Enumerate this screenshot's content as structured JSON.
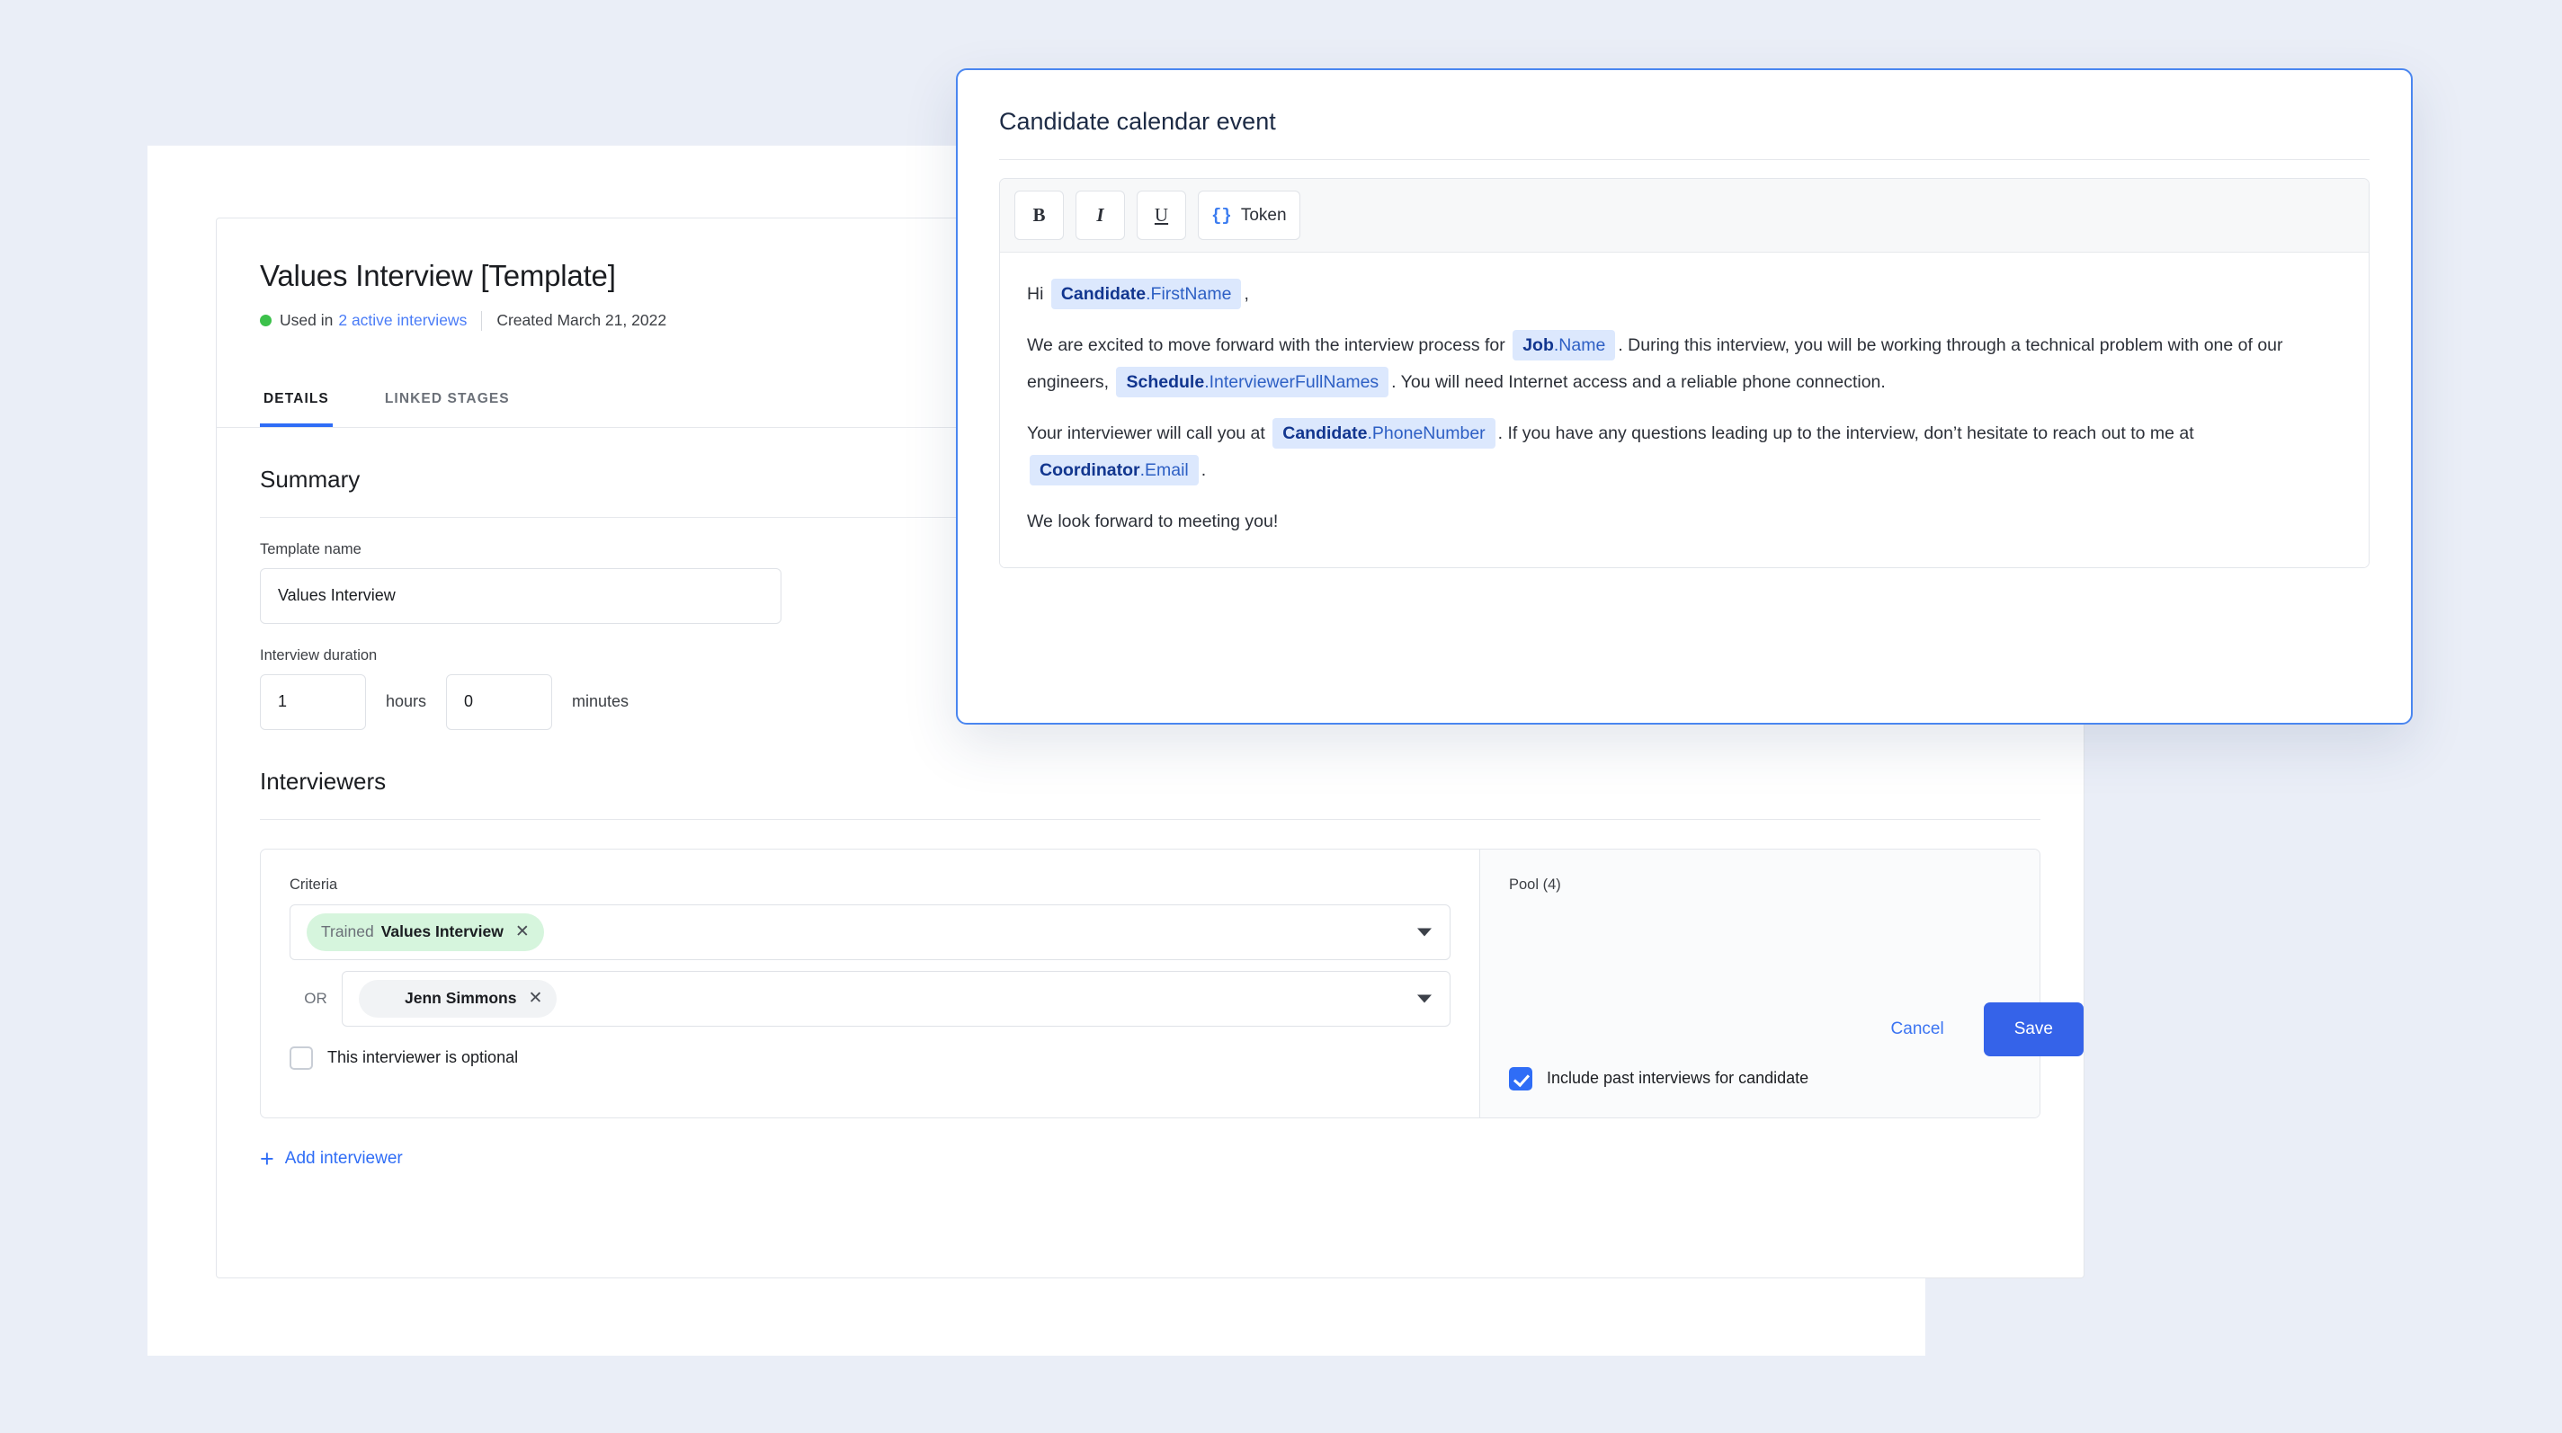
{
  "header": {
    "title": "Values Interview [Template]",
    "used_in_prefix": "Used in",
    "used_in_link": "2 active interviews",
    "created": "Created March 21, 2022"
  },
  "tabs": [
    {
      "label": "DETAILS",
      "active": true
    },
    {
      "label": "LINKED STAGES",
      "active": false
    }
  ],
  "summary": {
    "section_title": "Summary",
    "template_name_label": "Template name",
    "template_name_value": "Values Interview",
    "duration_label": "Interview duration",
    "hours_value": "1",
    "hours_unit": "hours",
    "minutes_value": "0",
    "minutes_unit": "minutes"
  },
  "interviewers": {
    "section_title": "Interviewers",
    "criteria_label": "Criteria",
    "criteria_chip": {
      "prefix": "Trained",
      "main": "Values Interview",
      "remove": "✕"
    },
    "or_label": "OR",
    "person_chip": {
      "name": "Jenn Simmons",
      "remove": "✕"
    },
    "optional_label": "This interviewer is optional",
    "optional_checked": false,
    "pool_label": "Pool (4)",
    "pool_avatars": [
      {
        "bg": "#f5d130",
        "hair": "#6b3a1f",
        "body": "#6ea3cf"
      },
      {
        "bg": "#8c2fd4",
        "hair": "#151215",
        "body": "#2b2b33"
      },
      {
        "bg": "#2f6df6",
        "hair": "#231a14",
        "body": "#2e3440"
      },
      {
        "bg": "#5ef0e2",
        "hair": "#c9a06a",
        "body": "#e6dfd6"
      }
    ],
    "include_past_label": "Include past interviews for candidate",
    "include_past_checked": true,
    "add_interviewer_label": "Add interviewer",
    "add_interviewer_icon": "+"
  },
  "modal": {
    "title": "Candidate calendar event",
    "toolbar": {
      "bold": "B",
      "italic": "I",
      "underline": "U",
      "token_braces": "{}",
      "token_label": "Token"
    },
    "body": [
      {
        "parts": [
          {
            "t": "text",
            "v": "Hi "
          },
          {
            "t": "token",
            "obj": "Candidate",
            "field": ".FirstName"
          },
          {
            "t": "text",
            "v": ","
          }
        ]
      },
      {
        "parts": [
          {
            "t": "text",
            "v": "We are excited to move forward with the interview process for "
          },
          {
            "t": "token",
            "obj": "Job",
            "field": ".Name"
          },
          {
            "t": "text",
            "v": ". During this interview, you will be working through a technical problem with one of our engineers, "
          },
          {
            "t": "token",
            "obj": "Schedule",
            "field": ".InterviewerFullNames"
          },
          {
            "t": "text",
            "v": ". You will need Internet access and a reliable phone connection."
          }
        ]
      },
      {
        "parts": [
          {
            "t": "text",
            "v": "Your interviewer will call you at "
          },
          {
            "t": "token",
            "obj": "Candidate",
            "field": ".PhoneNumber"
          },
          {
            "t": "text",
            "v": ". If you have any questions leading up to the interview, don’t hesitate to reach out to me at "
          },
          {
            "t": "token",
            "obj": "Coordinator",
            "field": ".Email"
          },
          {
            "t": "text",
            "v": "."
          }
        ]
      },
      {
        "parts": [
          {
            "t": "text",
            "v": "We look forward to meeting you!"
          }
        ]
      }
    ]
  },
  "footer": {
    "cancel_label": "Cancel",
    "save_label": "Save"
  },
  "colors": {
    "page_bg": "#eaeef7",
    "accent_blue": "#2f6df6",
    "save_blue": "#3563e9",
    "modal_border": "#4a86f0",
    "status_green": "#3cc14b",
    "chip_green_bg": "#d6f5dd",
    "token_bg": "#dce8fd"
  }
}
